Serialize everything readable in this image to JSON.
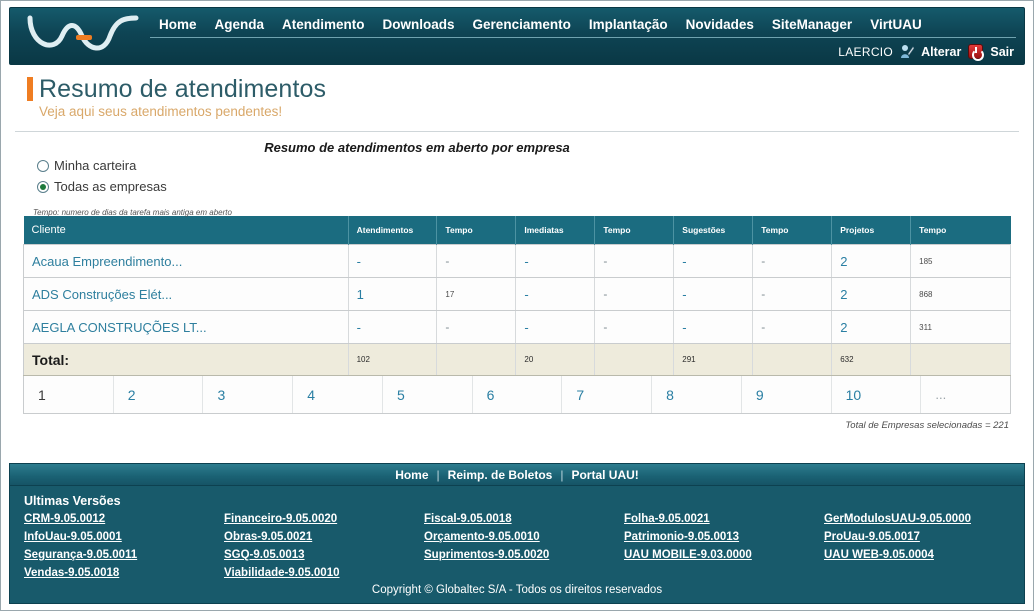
{
  "header": {
    "logo_alt": "UAU",
    "nav": [
      {
        "label": "Home"
      },
      {
        "label": "Agenda"
      },
      {
        "label": "Atendimento"
      },
      {
        "label": "Downloads"
      },
      {
        "label": "Gerenciamento"
      },
      {
        "label": "Implantação"
      },
      {
        "label": "Novidades"
      },
      {
        "label": "SiteManager"
      },
      {
        "label": "VirtUAU"
      }
    ],
    "user": {
      "name": "LAERCIO",
      "change_label": "Alterar",
      "logout_label": "Sair",
      "person_icon": "person-edit-icon",
      "power_icon": "power-icon"
    }
  },
  "page": {
    "title": "Resumo de atendimentos",
    "subtitle": "Veja aqui seus atendimentos pendentes!",
    "section_caption": "Resumo de atendimentos em aberto por empresa",
    "note": "Tempo: numero de dias da tarefa mais antiga em aberto",
    "accent_color": "#ef7d22"
  },
  "filters": {
    "options": [
      {
        "label": "Minha carteira",
        "checked": false
      },
      {
        "label": "Todas as empresas",
        "checked": true
      }
    ]
  },
  "table": {
    "columns": [
      "Cliente",
      "Atendimentos",
      "Tempo",
      "Imediatas",
      "Tempo",
      "Sugestões",
      "Tempo",
      "Projetos",
      "Tempo"
    ],
    "rows": [
      {
        "cliente": "Acaua Empreendimento...",
        "atendimentos": "-",
        "tempo1": "-",
        "imediatas": "-",
        "tempo2": "-",
        "sugestoes": "-",
        "tempo3": "-",
        "projetos": "2",
        "tempo4": "185"
      },
      {
        "cliente": "ADS Construções Elét...",
        "atendimentos": "1",
        "tempo1": "17",
        "imediatas": "-",
        "tempo2": "-",
        "sugestoes": "-",
        "tempo3": "-",
        "projetos": "2",
        "tempo4": "868"
      },
      {
        "cliente": "AEGLA CONSTRUÇÕES LT...",
        "atendimentos": "-",
        "tempo1": "-",
        "imediatas": "-",
        "tempo2": "-",
        "sugestoes": "-",
        "tempo3": "-",
        "projetos": "2",
        "tempo4": "311"
      }
    ],
    "total": {
      "label": "Total:",
      "atendimentos": "102",
      "tempo1": "",
      "imediatas": "20",
      "tempo2": "",
      "sugestoes": "291",
      "tempo3": "",
      "projetos": "632",
      "tempo4": ""
    }
  },
  "pagination": {
    "pages": [
      "1",
      "2",
      "3",
      "4",
      "5",
      "6",
      "7",
      "8",
      "9",
      "10",
      "..."
    ],
    "current": "1"
  },
  "summary": {
    "total_companies": "Total de Empresas selecionadas = 221"
  },
  "footer": {
    "nav": [
      {
        "label": "Home"
      },
      {
        "label": "Reimp. de Boletos"
      },
      {
        "label": "Portal UAU!"
      }
    ],
    "separator": "|",
    "versions_title": "Ultimas Versões",
    "versions": [
      "CRM-9.05.0012",
      "Financeiro-9.05.0020",
      "Fiscal-9.05.0018",
      "Folha-9.05.0021",
      "GerModulosUAU-9.05.0000",
      "InfoUau-9.05.0001",
      "Obras-9.05.0021",
      "Orçamento-9.05.0010",
      "Patrimonio-9.05.0013",
      "ProUau-9.05.0017",
      "Segurança-9.05.0011",
      "SGQ-9.05.0013",
      "Suprimentos-9.05.0020",
      "UAU MOBILE-9.03.0000",
      "UAU WEB-9.05.0004",
      "Vendas-9.05.0018",
      "Viabilidade-9.05.0010"
    ],
    "copyright": "Copyright © Globaltec S/A - Todos os direitos reservados"
  }
}
